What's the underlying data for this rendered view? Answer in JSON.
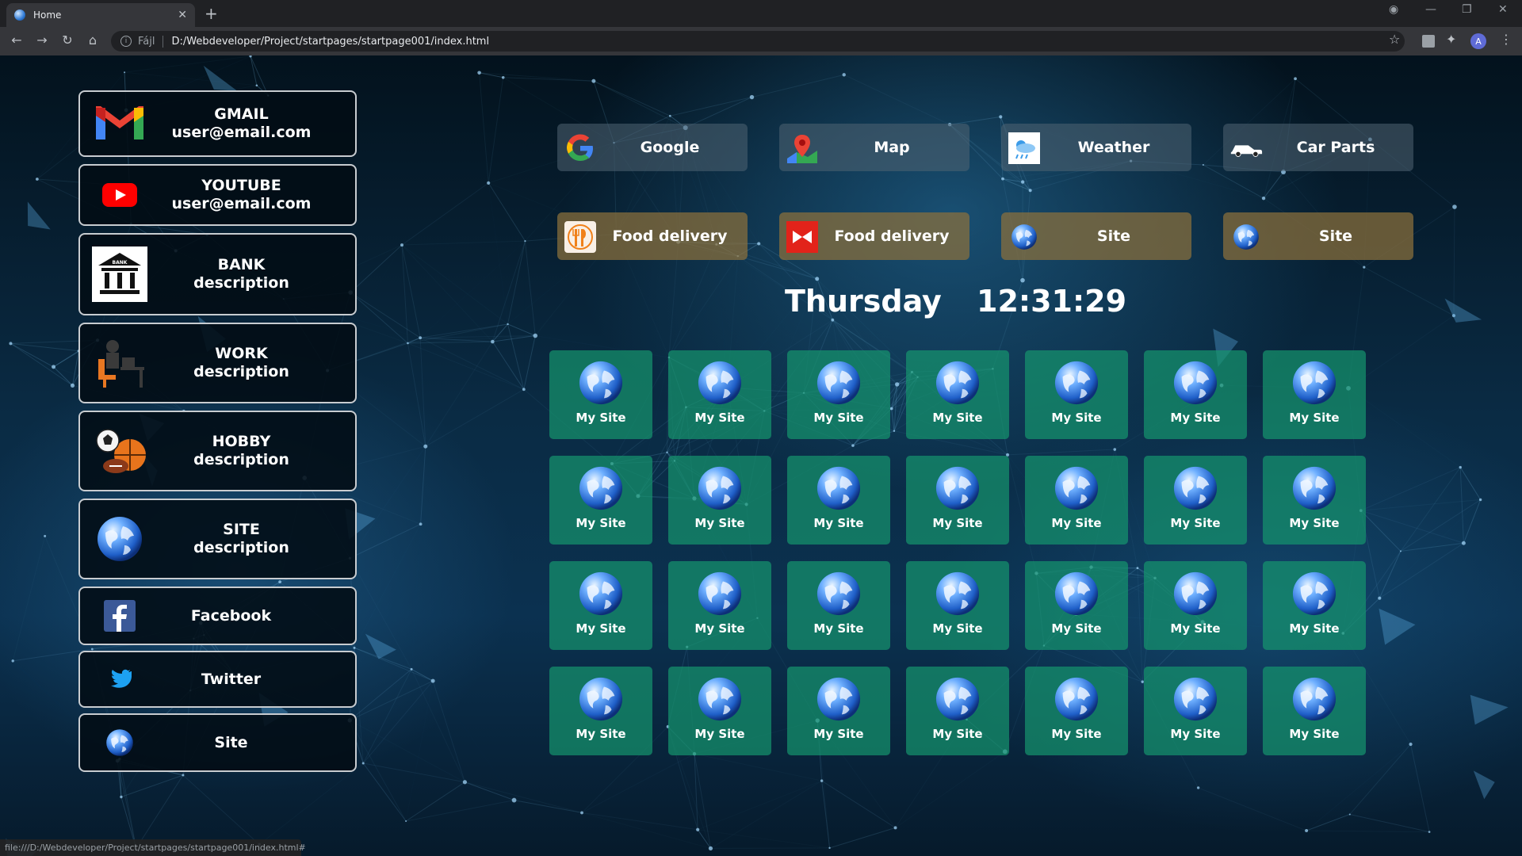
{
  "browser": {
    "tab_title": "Home",
    "scheme_label": "Fájl",
    "url": "D:/Webdeveloper/Project/startpages/startpage001/index.html",
    "avatar_letter": "A",
    "status_url": "file:///D:/Webdeveloper/Project/startpages/startpage001/index.html#"
  },
  "sidebar": [
    {
      "title": "GMAIL",
      "subtitle": "user@email.com",
      "icon": "gmail-icon"
    },
    {
      "title": "YOUTUBE",
      "subtitle": "user@email.com",
      "icon": "youtube-icon"
    },
    {
      "title": "BANK",
      "subtitle": "description",
      "icon": "bank-icon"
    },
    {
      "title": "WORK",
      "subtitle": "description",
      "icon": "work-desk-icon"
    },
    {
      "title": "HOBBY",
      "subtitle": "description",
      "icon": "sports-balls-icon"
    },
    {
      "title": "SITE",
      "subtitle": "description",
      "icon": "globe-icon"
    },
    {
      "title": "Facebook",
      "subtitle": "",
      "icon": "facebook-icon"
    },
    {
      "title": "Twitter",
      "subtitle": "",
      "icon": "twitter-icon"
    },
    {
      "title": "Site",
      "subtitle": "",
      "icon": "globe-icon"
    }
  ],
  "quick_links": [
    {
      "label": "Google",
      "icon": "google-icon"
    },
    {
      "label": "Map",
      "icon": "map-pin-icon"
    },
    {
      "label": "Weather",
      "icon": "weather-icon"
    },
    {
      "label": "Car Parts",
      "icon": "car-icon"
    },
    {
      "label": "Food delivery",
      "icon": "fork-knife-icon"
    },
    {
      "label": "Food delivery",
      "icon": "food-delivery-logo-icon"
    },
    {
      "label": "Site",
      "icon": "globe-icon"
    },
    {
      "label": "Site",
      "icon": "globe-icon"
    }
  ],
  "clock": {
    "day": "Thursday",
    "time": "12:31:29"
  },
  "tiles": {
    "label": "My Site",
    "icon": "globe-icon",
    "rows": 4,
    "columns": 7
  },
  "colors": {
    "tile_green": "#16966e",
    "quick_link_brown": "#8c703c",
    "quick_link_grey": "#506473"
  }
}
